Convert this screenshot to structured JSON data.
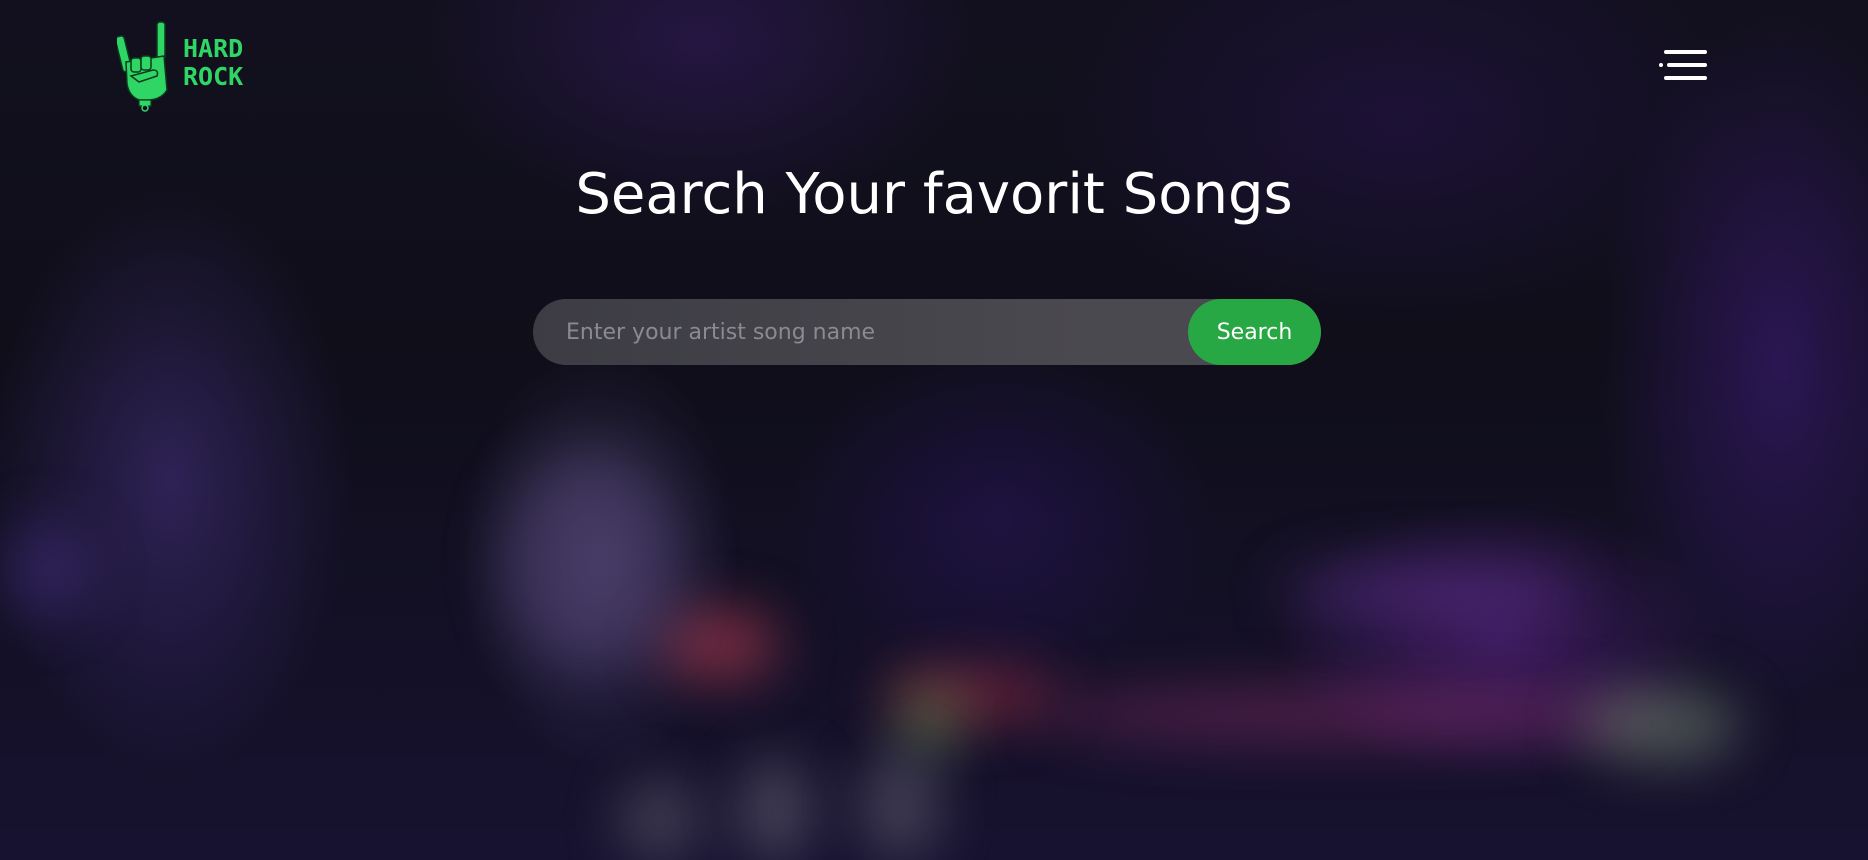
{
  "header": {
    "logo": {
      "line1": "HARD",
      "line2": "ROCK",
      "icon": "rock-hand-icon",
      "color": "#2fd666"
    },
    "menu": {
      "icon": "hamburger-menu-icon",
      "color": "#ffffff"
    }
  },
  "hero": {
    "title": "Search Your favorit Songs"
  },
  "search": {
    "placeholder": "Enter your artist song name",
    "value": "",
    "button_label": "Search",
    "button_color": "#27a844"
  }
}
